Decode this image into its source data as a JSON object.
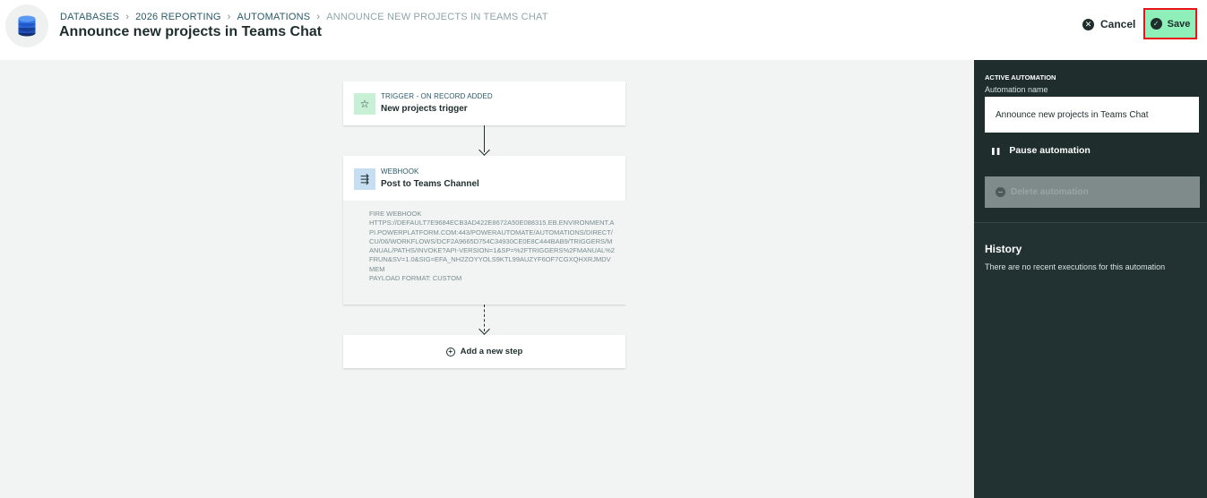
{
  "header": {
    "breadcrumb": [
      "DATABASES",
      "2026 REPORTING",
      "AUTOMATIONS",
      "ANNOUNCE NEW PROJECTS IN TEAMS CHAT"
    ],
    "title": "Announce new projects in Teams Chat",
    "cancel_label": "Cancel",
    "save_label": "Save"
  },
  "canvas": {
    "trigger": {
      "kind": "TRIGGER - ON RECORD ADDED",
      "name": "New projects trigger",
      "icon": "star-icon"
    },
    "webhook": {
      "kind": "WEBHOOK",
      "name": "Post to Teams Channel",
      "icon": "webhook-arrows-icon",
      "details": {
        "heading": "FIRE WEBHOOK",
        "url": "HTTPS://DEFAULT7E9684ECB3AD422E8672A50E088315.EB.ENVIRONMENT.API.POWERPLATFORM.COM:443/POWERAUTOMATE/AUTOMATIONS/DIRECT/CU/06/WORKFLOWS/DCF2A9665D754C34930CE0E8C444BAB9/TRIGGERS/MANUAL/PATHS/INVOKE?API-VERSION=1&SP=%2FTRIGGERS%2FMANUAL%2FRUN&SV=1.0&SIG=EFA_NH2ZOYYOLS9KTL99AUZYF6OF7CGXQHXRJMDVMEM",
        "payload": "PAYLOAD FORMAT: CUSTOM"
      }
    },
    "add_step_label": "Add a new step"
  },
  "panel": {
    "kicker": "ACTIVE AUTOMATION",
    "name_label": "Automation name",
    "name_value": "Announce new projects in Teams Chat",
    "pause_label": "Pause automation",
    "delete_label": "Delete automation",
    "history_title": "History",
    "history_empty": "There are no recent executions for this automation"
  },
  "colors": {
    "accent_save": "#8ef0b8",
    "save_outline": "#e8141a",
    "panel_bg": "#1f2d2d",
    "trigger_icon_bg": "#c8f0d4",
    "webhook_icon_bg": "#c6def2"
  }
}
